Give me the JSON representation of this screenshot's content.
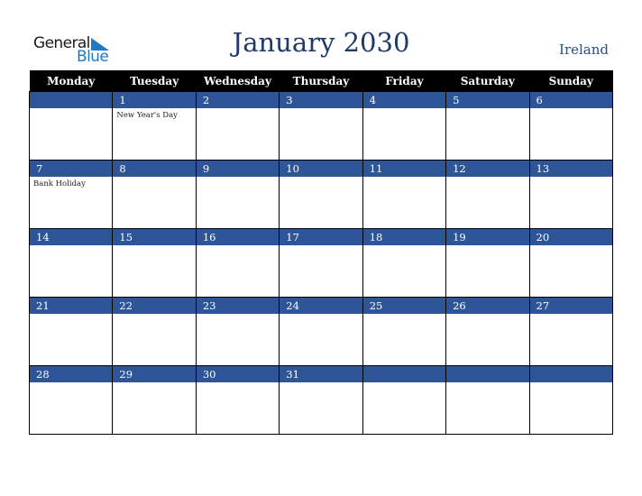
{
  "logo": {
    "line1": "General",
    "line2": "Blue"
  },
  "header": {
    "title": "January 2030",
    "country": "Ireland"
  },
  "weekdays": [
    "Monday",
    "Tuesday",
    "Wednesday",
    "Thursday",
    "Friday",
    "Saturday",
    "Sunday"
  ],
  "weeks": [
    [
      {
        "day": "",
        "holiday": ""
      },
      {
        "day": "1",
        "holiday": "New Year's Day"
      },
      {
        "day": "2",
        "holiday": ""
      },
      {
        "day": "3",
        "holiday": ""
      },
      {
        "day": "4",
        "holiday": ""
      },
      {
        "day": "5",
        "holiday": ""
      },
      {
        "day": "6",
        "holiday": ""
      }
    ],
    [
      {
        "day": "7",
        "holiday": "Bank Holiday"
      },
      {
        "day": "8",
        "holiday": ""
      },
      {
        "day": "9",
        "holiday": ""
      },
      {
        "day": "10",
        "holiday": ""
      },
      {
        "day": "11",
        "holiday": ""
      },
      {
        "day": "12",
        "holiday": ""
      },
      {
        "day": "13",
        "holiday": ""
      }
    ],
    [
      {
        "day": "14",
        "holiday": ""
      },
      {
        "day": "15",
        "holiday": ""
      },
      {
        "day": "16",
        "holiday": ""
      },
      {
        "day": "17",
        "holiday": ""
      },
      {
        "day": "18",
        "holiday": ""
      },
      {
        "day": "19",
        "holiday": ""
      },
      {
        "day": "20",
        "holiday": ""
      }
    ],
    [
      {
        "day": "21",
        "holiday": ""
      },
      {
        "day": "22",
        "holiday": ""
      },
      {
        "day": "23",
        "holiday": ""
      },
      {
        "day": "24",
        "holiday": ""
      },
      {
        "day": "25",
        "holiday": ""
      },
      {
        "day": "26",
        "holiday": ""
      },
      {
        "day": "27",
        "holiday": ""
      }
    ],
    [
      {
        "day": "28",
        "holiday": ""
      },
      {
        "day": "29",
        "holiday": ""
      },
      {
        "day": "30",
        "holiday": ""
      },
      {
        "day": "31",
        "holiday": ""
      },
      {
        "day": "",
        "holiday": ""
      },
      {
        "day": "",
        "holiday": ""
      },
      {
        "day": "",
        "holiday": ""
      }
    ]
  ],
  "colors": {
    "header_bg": "#000000",
    "day_bar": "#2e5597",
    "title": "#1f3a68",
    "logo_blue": "#1f78c1"
  }
}
